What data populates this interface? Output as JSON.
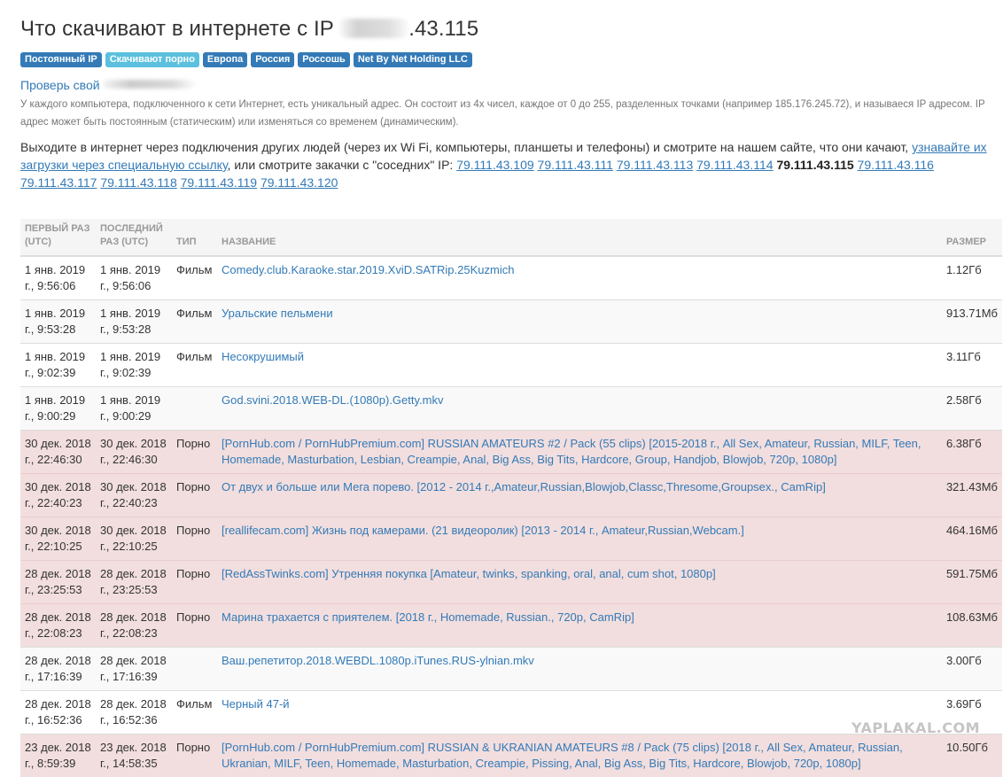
{
  "header": {
    "title_prefix": "Что скачивают в интернете с IP",
    "title_suffix": ".43.115"
  },
  "labels": [
    {
      "text": "Постоянный IP",
      "style": "primary"
    },
    {
      "text": "Скачивают порно",
      "style": "info"
    },
    {
      "text": "Европа",
      "style": "primary"
    },
    {
      "text": "Россия",
      "style": "primary"
    },
    {
      "text": "Россошь",
      "style": "primary"
    },
    {
      "text": "Net By Net Holding LLC",
      "style": "primary"
    }
  ],
  "check_link": "Проверь свой",
  "help_text": "У каждого компьютера, подключенного к сети Интернет, есть уникальный адрес. Он состоит из 4х чисел, каждое от 0 до 255, разделенных точками (например 185.176.245.72), и называеся IP адресом. IP адрес может быть постоянным (статическим) или изменяться со временем (динамическим).",
  "intro": {
    "text_before": "Выходите в интернет через подключения других людей (через их Wi Fi, компьютеры, планшеты и телефоны) и смотрите на нашем сайте, что они качают, ",
    "link_text": "узнавайте их загрузки через специальную ссылку",
    "text_after": ", или смотрите закачки с \"соседних\" IP: ",
    "neighbor_ips": [
      "79.111.43.109",
      "79.111.43.111",
      "79.111.43.113",
      "79.111.43.114",
      "79.111.43.115",
      "79.111.43.116",
      "79.111.43.117",
      "79.111.43.118",
      "79.111.43.119",
      "79.111.43.120"
    ],
    "current_ip": "79.111.43.115"
  },
  "table": {
    "headers": {
      "first": "Первый раз (UTC)",
      "last": "Последний раз (UTC)",
      "type": "Тип",
      "name": "Название",
      "size": "Размер"
    },
    "rows": [
      {
        "first": "1 янв. 2019 г., 9:56:06",
        "last": "1 янв. 2019 г., 9:56:06",
        "type": "Фильм",
        "name": "Comedy.club.Karaoke.star.2019.XviD.SATRip.25Kuzmich",
        "size": "1.12Гб",
        "porn": false
      },
      {
        "first": "1 янв. 2019 г., 9:53:28",
        "last": "1 янв. 2019 г., 9:53:28",
        "type": "Фильм",
        "name": "Уральские пельмени",
        "size": "913.71Мб",
        "porn": false
      },
      {
        "first": "1 янв. 2019 г., 9:02:39",
        "last": "1 янв. 2019 г., 9:02:39",
        "type": "Фильм",
        "name": "Несокрушимый",
        "size": "3.11Гб",
        "porn": false
      },
      {
        "first": "1 янв. 2019 г., 9:00:29",
        "last": "1 янв. 2019 г., 9:00:29",
        "type": "",
        "name": "God.svini.2018.WEB-DL.(1080p).Getty.mkv",
        "size": "2.58Гб",
        "porn": false
      },
      {
        "first": "30 дек. 2018 г., 22:46:30",
        "last": "30 дек. 2018 г., 22:46:30",
        "type": "Порно",
        "name": "[PornHub.com / PornHubPremium.com] RUSSIAN AMATEURS #2 / Pack (55 clips) [2015-2018 г., All Sex, Amateur, Russian, MILF, Teen, Homemade, Masturbation, Lesbian, Creampie, Anal, Big Ass, Big Tits, Hardcore, Group, Handjob, Blowjob, 720p, 1080p]",
        "size": "6.38Гб",
        "porn": true
      },
      {
        "first": "30 дек. 2018 г., 22:40:23",
        "last": "30 дек. 2018 г., 22:40:23",
        "type": "Порно",
        "name": "От двух и больше или Мега порево. [2012 - 2014 г.,Amateur,Russian,Blowjob,Classc,Thresome,Groupsex., CamRip]",
        "size": "321.43Мб",
        "porn": true
      },
      {
        "first": "30 дек. 2018 г., 22:10:25",
        "last": "30 дек. 2018 г., 22:10:25",
        "type": "Порно",
        "name": "[reallifecam.com] Жизнь под камерами. (21 видеоролик) [2013 - 2014 г., Amateur,Russian,Webcam.]",
        "size": "464.16Мб",
        "porn": true
      },
      {
        "first": "28 дек. 2018 г., 23:25:53",
        "last": "28 дек. 2018 г., 23:25:53",
        "type": "Порно",
        "name": "[RedAssTwinks.com] Утренняя покупка [Amateur, twinks, spanking, oral, anal, cum shot, 1080p]",
        "size": "591.75Мб",
        "porn": true
      },
      {
        "first": "28 дек. 2018 г., 22:08:23",
        "last": "28 дек. 2018 г., 22:08:23",
        "type": "Порно",
        "name": "Марина трахается с приятелем. [2018 г., Homemade, Russian., 720p, CamRip]",
        "size": "108.63Мб",
        "porn": true
      },
      {
        "first": "28 дек. 2018 г., 17:16:39",
        "last": "28 дек. 2018 г., 17:16:39",
        "type": "",
        "name": "Ваш.репетитор.2018.WEBDL.1080p.iTunes.RUS-ylnian.mkv",
        "size": "3.00Гб",
        "porn": false
      },
      {
        "first": "28 дек. 2018 г., 16:52:36",
        "last": "28 дек. 2018 г., 16:52:36",
        "type": "Фильм",
        "name": "Черный 47-й",
        "size": "3.69Гб",
        "porn": false
      },
      {
        "first": "23 дек. 2018 г., 8:59:39",
        "last": "23 дек. 2018 г., 14:58:35",
        "type": "Порно",
        "name": "[PornHub.com / PornHubPremium.com] RUSSIAN & UKRANIAN AMATEURS #8 / Pack (75 clips) [2018 г., All Sex, Amateur, Russian, Ukranian, MILF, Teen, Homemade, Masturbation, Creampie, Pissing, Anal, Big Ass, Big Tits, Hardcore, Blowjob, 720p, 1080p]",
        "size": "10.50Гб",
        "porn": true
      }
    ]
  },
  "watermark": "YAPLAKAL.COM"
}
